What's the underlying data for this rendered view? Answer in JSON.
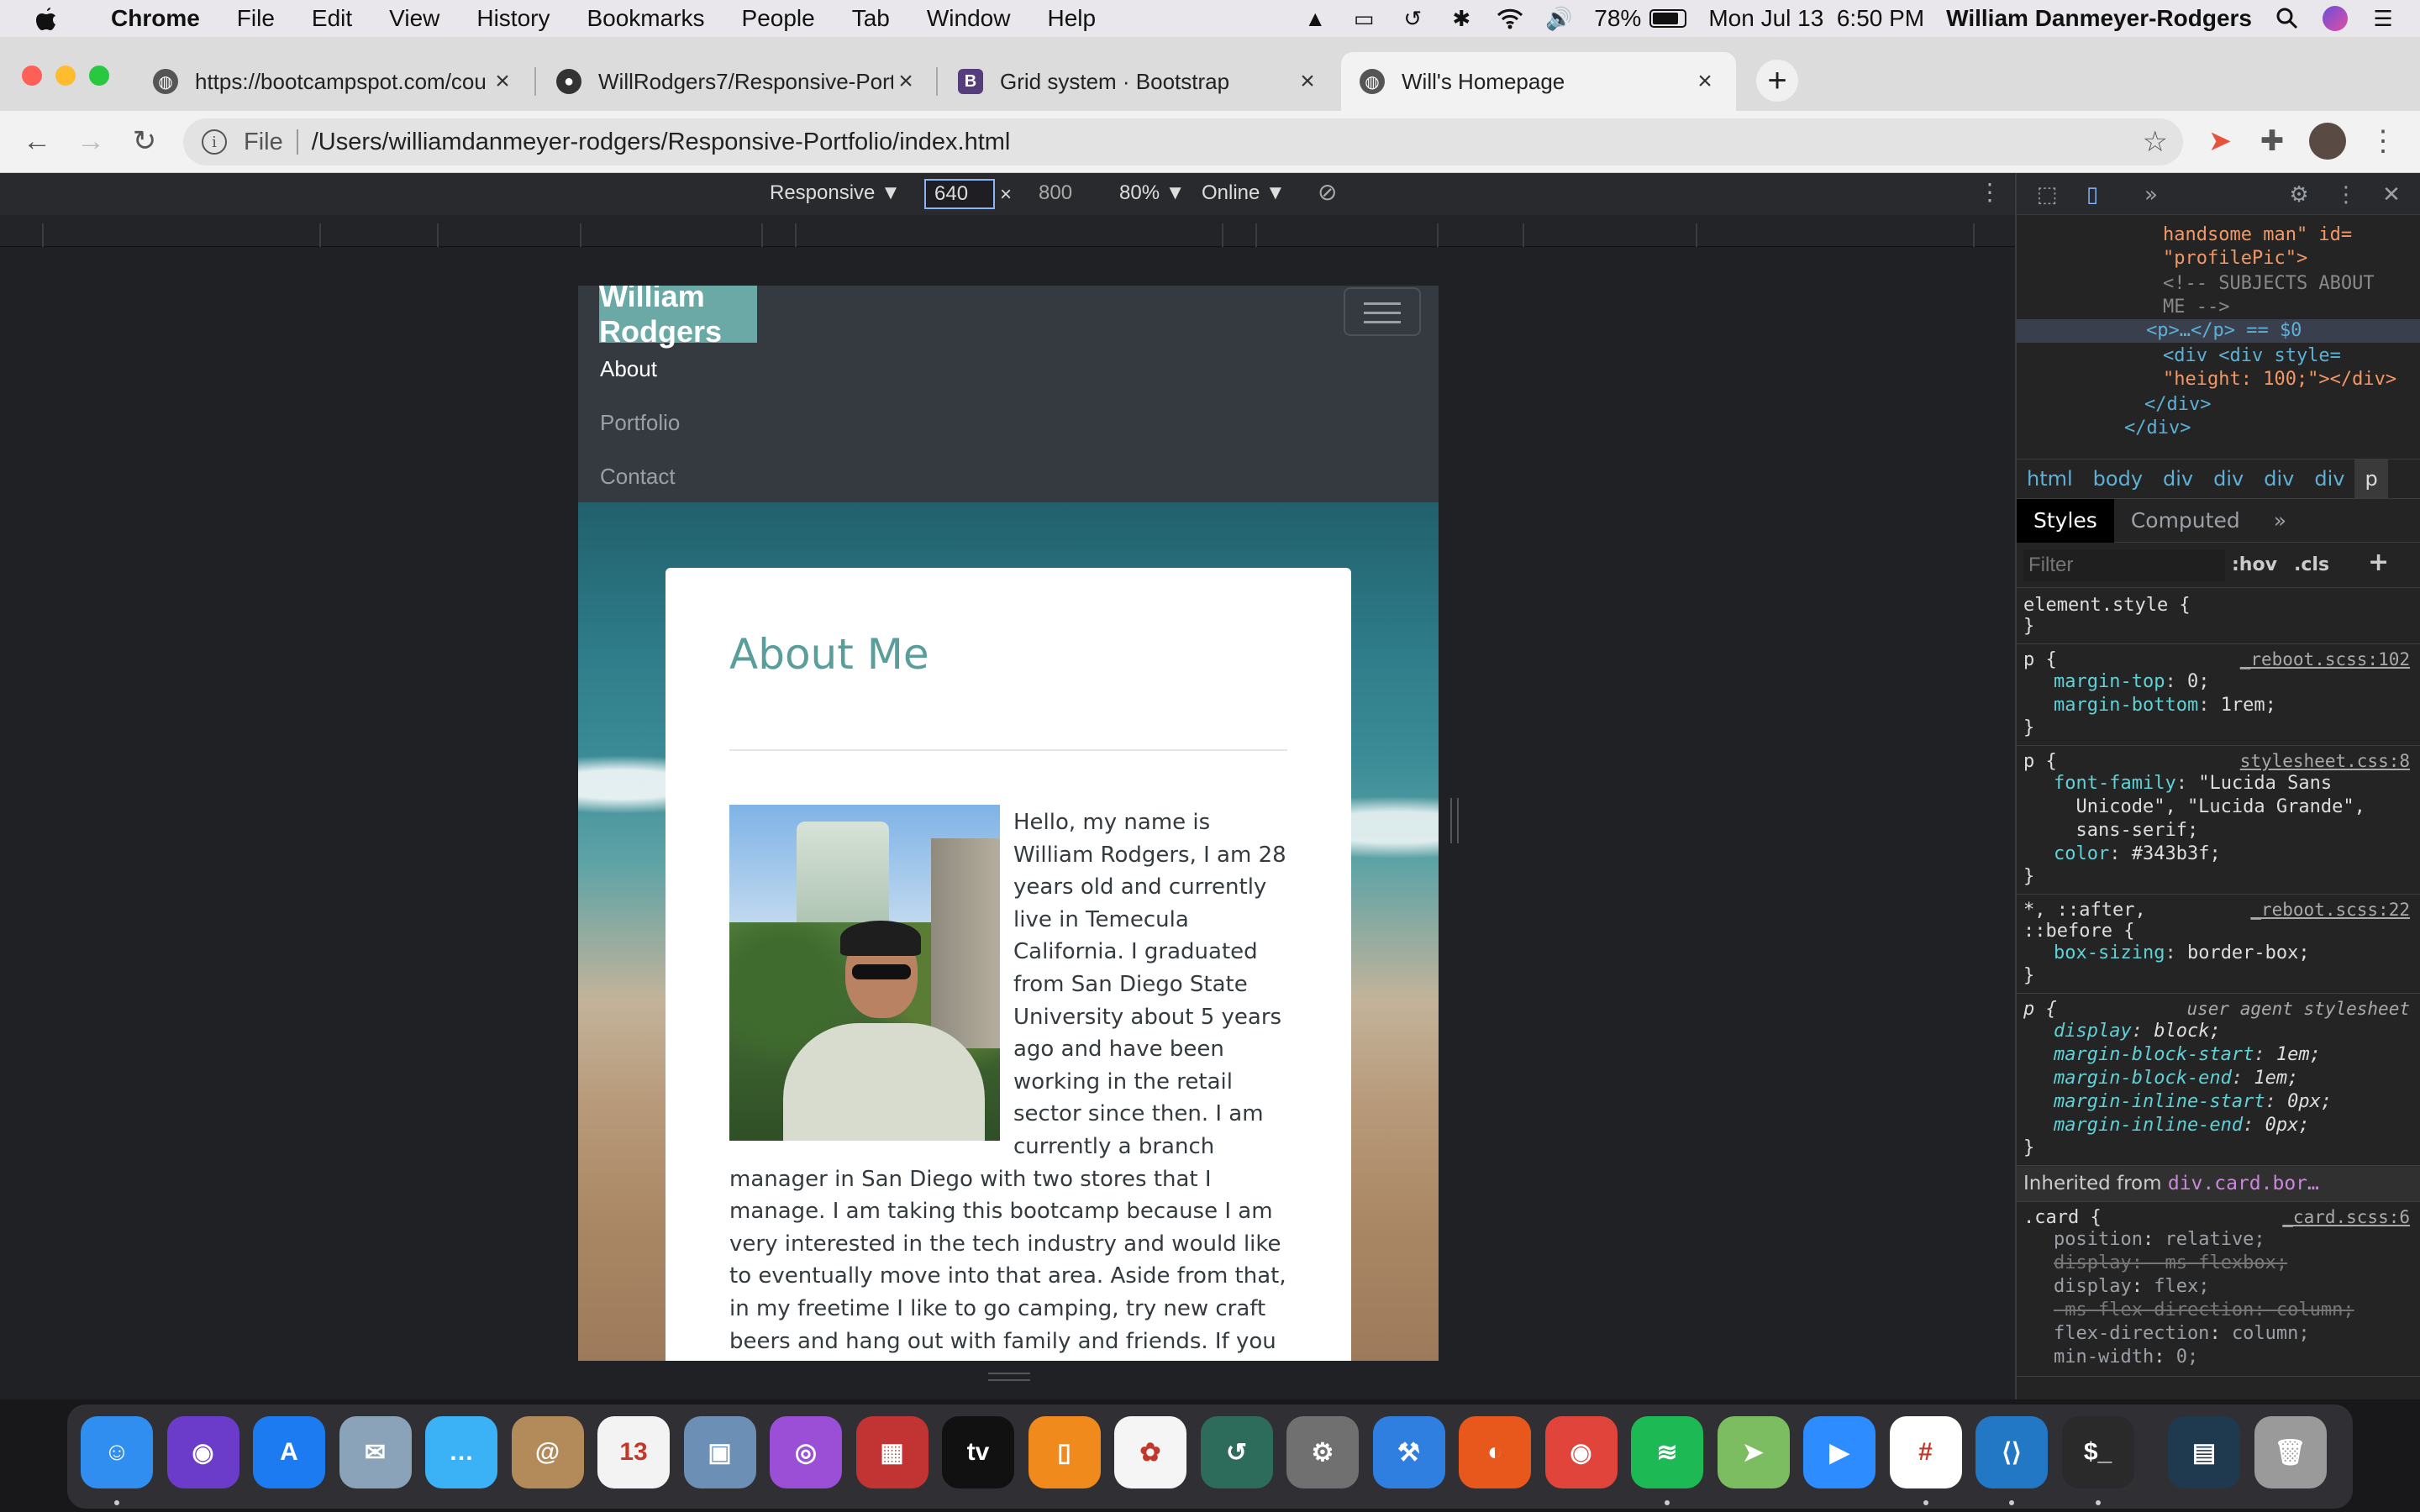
{
  "menubar": {
    "app_name": "Chrome",
    "menus": [
      "File",
      "Edit",
      "View",
      "History",
      "Bookmarks",
      "People",
      "Tab",
      "Window",
      "Help"
    ],
    "battery": "78%",
    "datetime": "Mon Jul 13  6:50 PM",
    "user": "William Danmeyer-Rodgers"
  },
  "tabs": [
    {
      "title": "https://bootcampspot.com/cou",
      "icon": "globe-icon"
    },
    {
      "title": "WillRodgers7/Responsive-Port",
      "icon": "github-icon"
    },
    {
      "title": "Grid system · Bootstrap",
      "icon": "bootstrap-icon",
      "icon_text": "B"
    },
    {
      "title": "Will's Homepage",
      "icon": "globe-icon",
      "active": true
    }
  ],
  "omnibox": {
    "scheme_label": "File",
    "url": "/Users/williamdanmeyer-rodgers/Responsive-Portfolio/index.html"
  },
  "device_toolbar": {
    "mode": "Responsive ▼",
    "width": "640",
    "times": "×",
    "height": "800",
    "zoom": "80% ▼",
    "network": "Online ▼"
  },
  "site": {
    "brand": "William Rodgers",
    "nav": [
      "About",
      "Portfolio",
      "Contact"
    ],
    "heading": "About Me",
    "bio": "Hello, my name is William Rodgers, I am 28 years old and currently live in Temecula California. I graduated from San Diego State University about 5 years ago and have been working in the retail sector since then. I am currently a branch manager in San Diego with two stores that I manage. I am taking this bootcamp because I am very interested in the tech industry and would like to eventually move into that area. Aside from that, in my freetime I like to go camping, try new craft beers and hang out with family and friends. If you would",
    "photo_alt": "handsome man"
  },
  "devtools": {
    "dom": [
      "handsome man\" id=",
      "\"profilePic\">",
      "<!-- SUBJECTS ABOUT",
      "ME -->",
      "<p>…</p> == $0",
      "<div <div style=",
      "\"height: 100;\"></div>",
      "</div>",
      "</div>"
    ],
    "breadcrumbs": [
      "html",
      "body",
      "div",
      "div",
      "div",
      "div",
      "p"
    ],
    "subtabs": [
      "Styles",
      "Computed"
    ],
    "filter_placeholder": "Filter",
    "hov": ":hov",
    "cls": ".cls",
    "element_style": "element.style {",
    "rules": [
      {
        "selector": "p {",
        "source": "_reboot.scss:102",
        "props": [
          [
            "margin-top",
            "0;"
          ],
          [
            "margin-bottom",
            "1rem;"
          ]
        ]
      },
      {
        "selector": "p {",
        "source": "stylesheet.css:8",
        "props": [
          [
            "font-family",
            "\"Lucida Sans"
          ],
          [
            "",
            "  Unicode\", \"Lucida Grande\","
          ],
          [
            "",
            "  sans-serif;"
          ],
          [
            "color",
            "#343b3f;"
          ]
        ]
      },
      {
        "selector": "*, ::after,",
        "selector2": "::before {",
        "source": "_reboot.scss:22",
        "props": [
          [
            "box-sizing",
            "border-box;"
          ]
        ]
      },
      {
        "selector": "p {",
        "source": "user agent stylesheet",
        "ua": true,
        "props": [
          [
            "display",
            "block;"
          ],
          [
            "margin-block-start",
            "1em;"
          ],
          [
            "margin-block-end",
            "1em;"
          ],
          [
            "margin-inline-start",
            "0px;"
          ],
          [
            "margin-inline-end",
            "0px;"
          ]
        ]
      }
    ],
    "inherited_label": "Inherited from",
    "inherited_from": "div.card.bor…",
    "card_rule": {
      "selector": ".card {",
      "source": "_card.scss:6",
      "props": [
        [
          "position",
          "relative;",
          false
        ],
        [
          "display",
          "-ms-flexbox;",
          true
        ],
        [
          "display",
          "flex;",
          false
        ],
        [
          "-ms-flex-direction",
          "column;",
          true
        ],
        [
          "flex-direction",
          "column;",
          false
        ],
        [
          "min-width",
          "0;",
          false
        ]
      ]
    }
  },
  "dock": [
    {
      "name": "finder-icon",
      "color": "#2f8ef0",
      "text": "☺"
    },
    {
      "name": "siri-icon",
      "color": "#6a3cc9",
      "text": "◉"
    },
    {
      "name": "app-store-icon",
      "color": "#1d7bf2",
      "text": "A"
    },
    {
      "name": "mail-stamp-icon",
      "color": "#8aa3b8",
      "text": "✉"
    },
    {
      "name": "messages-icon",
      "color": "#3bb2f5",
      "text": "…"
    },
    {
      "name": "contacts-icon",
      "color": "#b38a5a",
      "text": "@"
    },
    {
      "name": "calendar-icon",
      "color": "#f3f3f3",
      "text": "13"
    },
    {
      "name": "preview-icon",
      "color": "#6b8fb5",
      "text": "▣"
    },
    {
      "name": "podcasts-icon",
      "color": "#9a4fd6",
      "text": "◎"
    },
    {
      "name": "photo-booth-icon",
      "color": "#c23434",
      "text": "▦"
    },
    {
      "name": "apple-tv-icon",
      "color": "#111111",
      "text": "tv"
    },
    {
      "name": "books-icon",
      "color": "#f08a1d",
      "text": "▯"
    },
    {
      "name": "photos-icon",
      "color": "#f5f5f5",
      "text": "✿"
    },
    {
      "name": "time-machine-icon",
      "color": "#2d6b5b",
      "text": "↺"
    },
    {
      "name": "system-preferences-icon",
      "color": "#707070",
      "text": "⚙"
    },
    {
      "name": "xcode-icon",
      "color": "#2f7fe0",
      "text": "⚒"
    },
    {
      "name": "firefox-icon",
      "color": "#e8581c",
      "text": "◐"
    },
    {
      "name": "chrome-icon",
      "color": "#e0443a",
      "text": "◉"
    },
    {
      "name": "spotify-icon",
      "color": "#1db954",
      "text": "≋"
    },
    {
      "name": "maps-icon",
      "color": "#7dbd61",
      "text": "➤"
    },
    {
      "name": "zoom-icon",
      "color": "#2d8cff",
      "text": "▶"
    },
    {
      "name": "slack-icon",
      "color": "#ffffff",
      "text": "#"
    },
    {
      "name": "vscode-icon",
      "color": "#2378c6",
      "text": "⟨⟩"
    },
    {
      "name": "terminal-icon",
      "color": "#2a2a2a",
      "text": "$_"
    },
    {
      "name": "screen-thumbnail-icon",
      "color": "#1f3a4f",
      "text": "▤"
    },
    {
      "name": "trash-icon",
      "color": "#9a9a9a",
      "text": "🗑"
    }
  ],
  "colors": {
    "brand_bg": "#6aa9a6",
    "heading": "#5a9e9c",
    "navbar": "#343a40",
    "text": "#343b3f"
  }
}
